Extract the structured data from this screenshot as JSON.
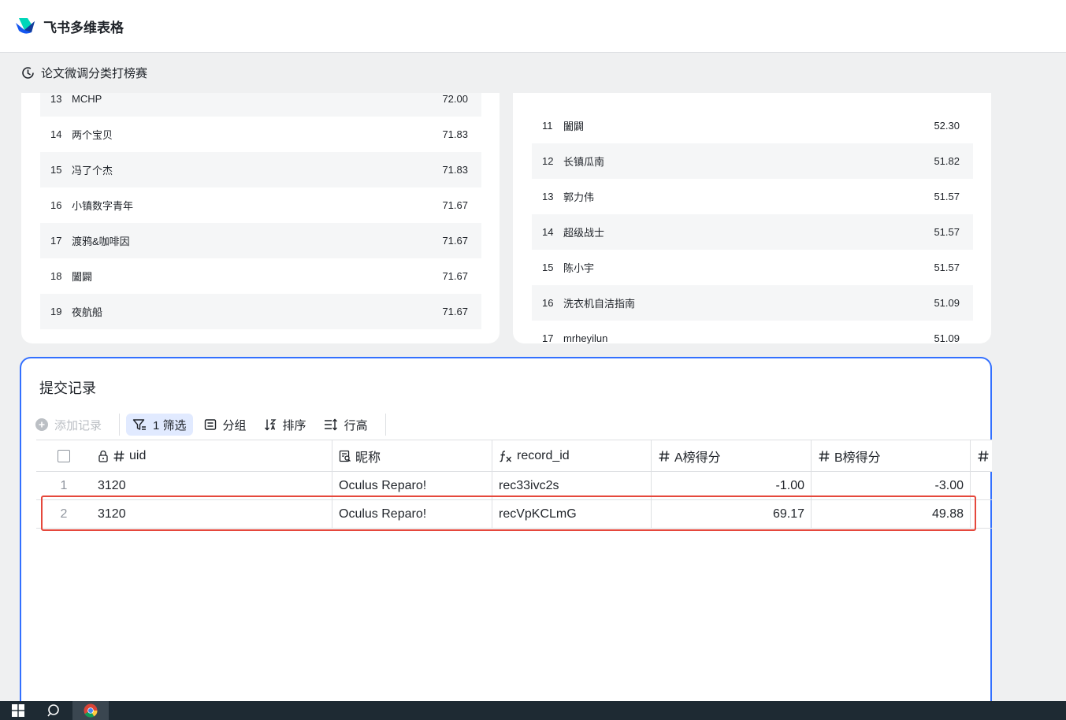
{
  "app": {
    "title": "飞书多维表格"
  },
  "dashboard": {
    "title": "论文微调分类打榜赛"
  },
  "leaderboard_left": [
    {
      "rank": "13",
      "name": "MCHP",
      "score": "72.00"
    },
    {
      "rank": "14",
      "name": "两个宝贝",
      "score": "71.83"
    },
    {
      "rank": "15",
      "name": "冯了个杰",
      "score": "71.83"
    },
    {
      "rank": "16",
      "name": "小镇数字青年",
      "score": "71.67"
    },
    {
      "rank": "17",
      "name": "渡鸦&咖啡因",
      "score": "71.67"
    },
    {
      "rank": "18",
      "name": "闔闢",
      "score": "71.67"
    },
    {
      "rank": "19",
      "name": "夜航船",
      "score": "71.67"
    }
  ],
  "leaderboard_right": [
    {
      "rank": "11",
      "name": "闔闢",
      "score": "52.30"
    },
    {
      "rank": "12",
      "name": "长镇瓜南",
      "score": "51.82"
    },
    {
      "rank": "13",
      "name": "郭力伟",
      "score": "51.57"
    },
    {
      "rank": "14",
      "name": "超级战士",
      "score": "51.57"
    },
    {
      "rank": "15",
      "name": "陈小宇",
      "score": "51.57"
    },
    {
      "rank": "16",
      "name": "洗衣机自洁指南",
      "score": "51.09"
    },
    {
      "rank": "17",
      "name": "mrheyilun",
      "score": "51.09"
    }
  ],
  "submissions": {
    "title": "提交记录",
    "toolbar": {
      "add": "添加记录",
      "filter": "1 筛选",
      "group": "分组",
      "sort": "排序",
      "row_height": "行高"
    },
    "columns": {
      "uid": "uid",
      "nickname": "昵称",
      "record_id": "record_id",
      "a_score": "A榜得分",
      "b_score": "B榜得分"
    },
    "rows": [
      {
        "index": "1",
        "uid": "3120",
        "nickname": "Oculus Reparo!",
        "record_id": "rec33ivc2s",
        "a_score": "-1.00",
        "b_score": "-3.00"
      },
      {
        "index": "2",
        "uid": "3120",
        "nickname": "Oculus Reparo!",
        "record_id": "recVpKCLmG",
        "a_score": "69.17",
        "b_score": "49.88"
      }
    ]
  },
  "colors": {
    "accent": "#3370ff",
    "highlight": "#e5483c",
    "filter_bg": "#e1eaff"
  }
}
